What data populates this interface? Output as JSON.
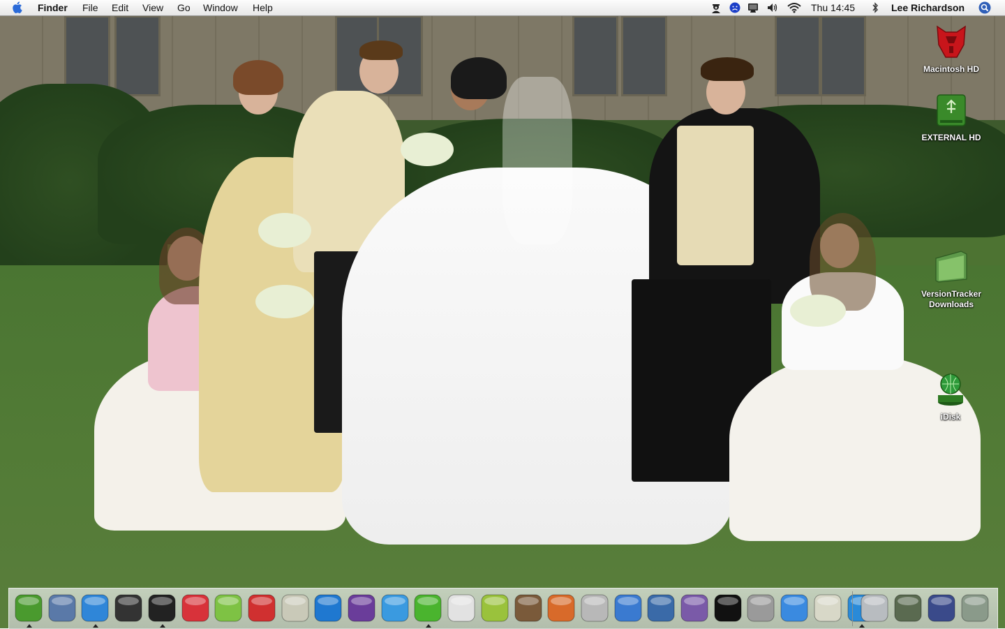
{
  "menubar": {
    "app_name": "Finder",
    "menus": [
      "File",
      "Edit",
      "View",
      "Go",
      "Window",
      "Help"
    ],
    "clock": "Thu 14:45",
    "user_name": "Lee Richardson",
    "status_icons": [
      "spy-icon",
      "blue-face-icon",
      "display-icon",
      "volume-icon",
      "wifi-icon",
      "bluetooth-icon",
      "spotlight-icon"
    ]
  },
  "desktop_icons": [
    {
      "label": "Macintosh HD",
      "icon": "autobot-drive-icon",
      "color": "#c8151b"
    },
    {
      "label": "EXTERNAL HD",
      "icon": "external-drive-icon",
      "color": "#3a8a2a"
    },
    {
      "label": "VersionTracker Downloads",
      "icon": "folder-icon",
      "color": "#5e9a4a"
    },
    {
      "label": "iDisk",
      "icon": "idisk-icon",
      "color": "#2e9a3a"
    }
  ],
  "dock": {
    "apps": [
      {
        "name": "finder-icon",
        "color": "#4a9a2e",
        "running": true
      },
      {
        "name": "mail-icon",
        "color": "#5a79a8",
        "running": false
      },
      {
        "name": "safari-icon",
        "color": "#2f86d8",
        "running": true
      },
      {
        "name": "photo-booth-icon",
        "color": "#333333",
        "running": false
      },
      {
        "name": "dashboard-icon",
        "color": "#222222",
        "running": true
      },
      {
        "name": "font-book-icon",
        "color": "#d8323a",
        "running": false
      },
      {
        "name": "itunes-icon",
        "color": "#7ec244",
        "running": false
      },
      {
        "name": "ical-icon",
        "color": "#d03030",
        "running": false
      },
      {
        "name": "textedit-icon",
        "color": "#c9c9b8",
        "running": false
      },
      {
        "name": "internet-explorer-icon",
        "color": "#1f78d0",
        "running": false
      },
      {
        "name": "adium-icon",
        "color": "#6a3d9a",
        "running": false
      },
      {
        "name": "msn-messenger-icon",
        "color": "#3a9ae0",
        "running": false
      },
      {
        "name": "skype-icon",
        "color": "#4ab42e",
        "running": true
      },
      {
        "name": "pages-icon",
        "color": "#e2e2e2",
        "running": false
      },
      {
        "name": "pushpin-icon",
        "color": "#9ac23c",
        "running": false
      },
      {
        "name": "iphoto-icon",
        "color": "#7a5a3a",
        "running": false
      },
      {
        "name": "photo-app-icon",
        "color": "#d86a2a",
        "running": false
      },
      {
        "name": "toaster-icon",
        "color": "#b8b8b8",
        "running": false
      },
      {
        "name": "ichat-icon",
        "color": "#3a7ad0",
        "running": false
      },
      {
        "name": "keynote-icon",
        "color": "#3a6aa8",
        "running": false
      },
      {
        "name": "simcity-icon",
        "color": "#7a5aa8",
        "running": false
      },
      {
        "name": "sc4-icon",
        "color": "#111111",
        "running": false
      },
      {
        "name": "system-prefs-icon",
        "color": "#9a9a9a",
        "running": false
      },
      {
        "name": "time-machine-icon",
        "color": "#3a8ae0",
        "running": false
      },
      {
        "name": "script-editor-icon",
        "color": "#d8d8c8",
        "running": false
      },
      {
        "name": "quicktime-icon",
        "color": "#2a8ad8",
        "running": true
      }
    ],
    "docs": [
      {
        "name": "internet-location-icon",
        "color": "#b8bcc0"
      },
      {
        "name": "screenshot-doc-icon",
        "color": "#5a6a50"
      },
      {
        "name": "photo-stack-icon",
        "color": "#3a4a8a"
      },
      {
        "name": "trash-icon",
        "color": "#8a9a8a"
      }
    ]
  }
}
